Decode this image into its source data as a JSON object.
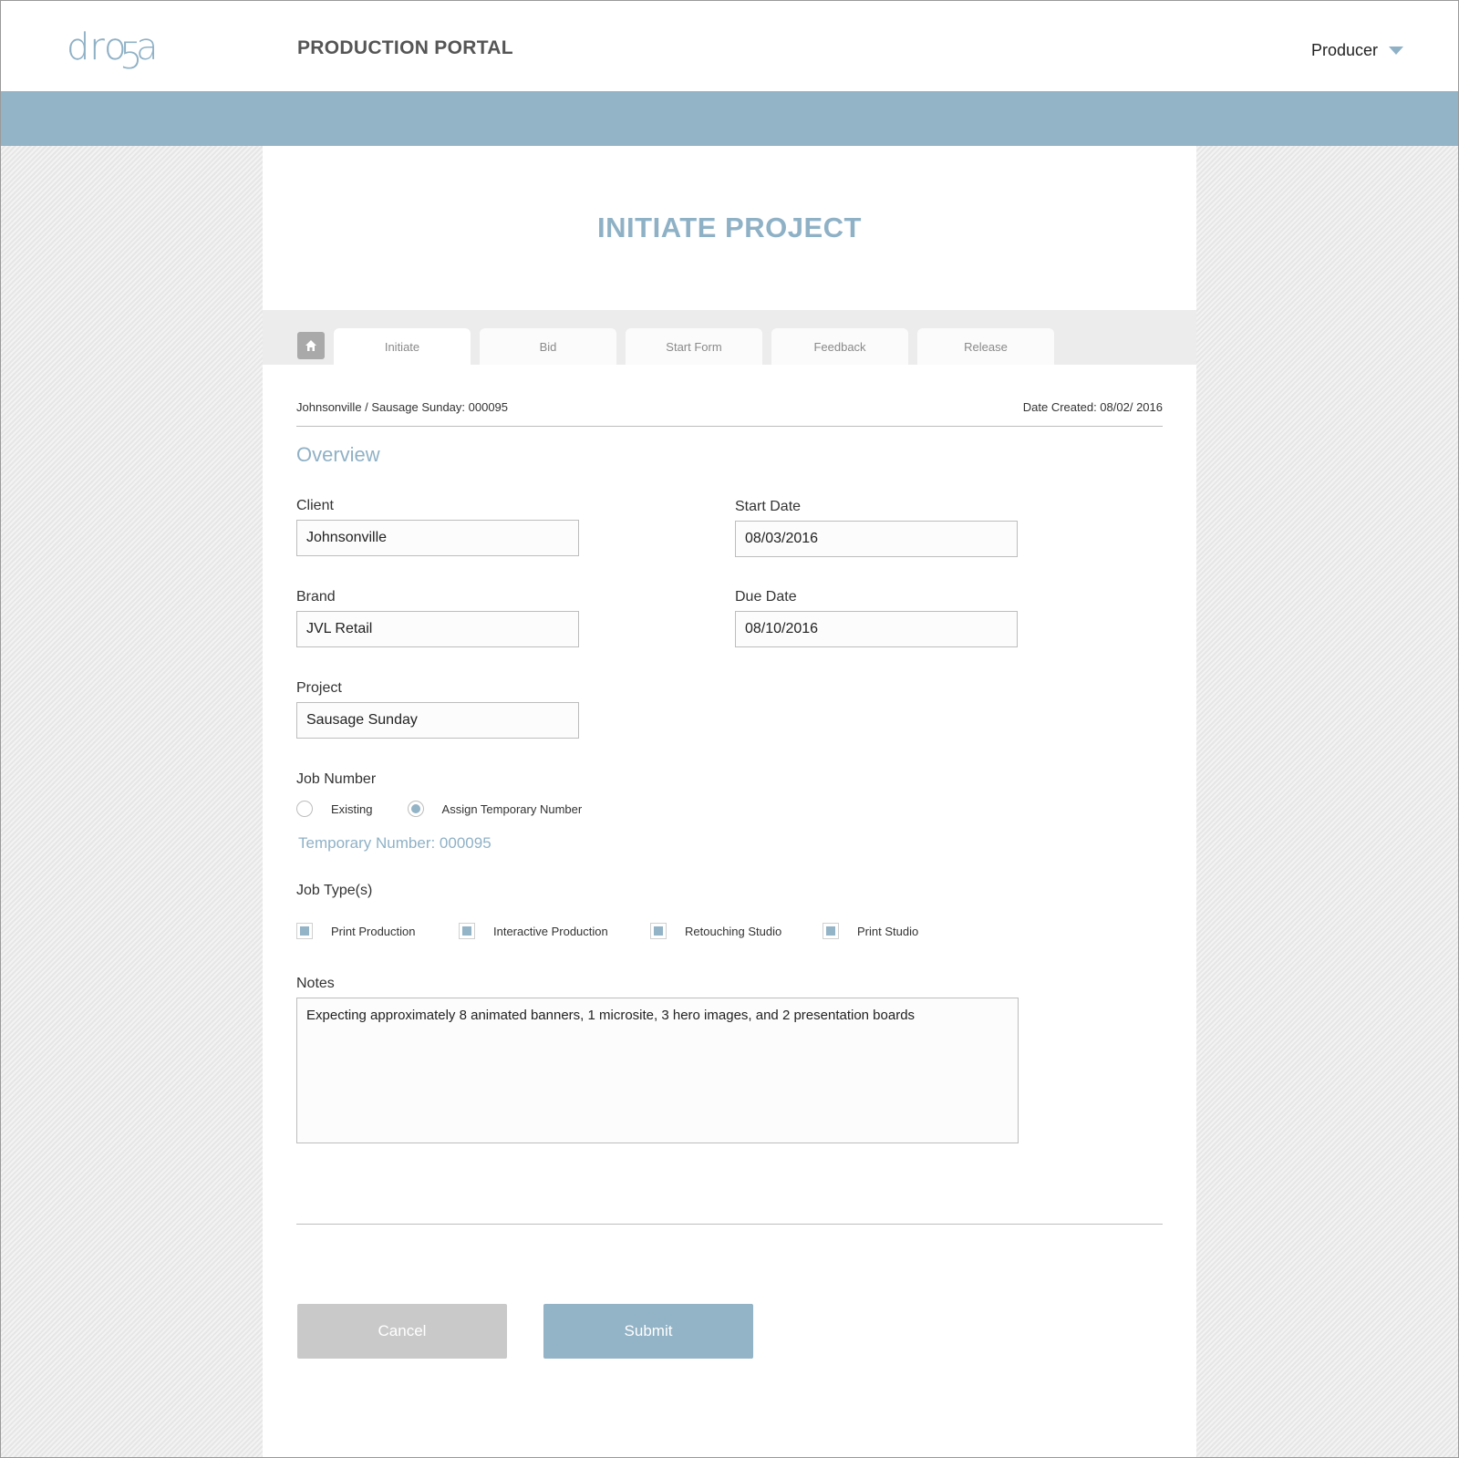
{
  "brand": {
    "logo_text": "dro5a",
    "accent_color": "#8fb1c6"
  },
  "header": {
    "portal_title": "PRODUCTION PORTAL",
    "user_role": "Producer",
    "user_menu_icon": "chevron-down-icon"
  },
  "page": {
    "title": "INITIATE PROJECT"
  },
  "tabs": {
    "home_icon": "home-icon",
    "items": [
      {
        "label": "Initiate",
        "active": true
      },
      {
        "label": "Bid",
        "active": false
      },
      {
        "label": "Start Form",
        "active": false
      },
      {
        "label": "Feedback",
        "active": false
      },
      {
        "label": "Release",
        "active": false
      }
    ]
  },
  "meta": {
    "breadcrumb": "Johnsonville / Sausage Sunday: 000095",
    "date_created": "Date Created: 08/02/ 2016"
  },
  "form": {
    "section_title": "Overview",
    "client": {
      "label": "Client",
      "value": "Johnsonville"
    },
    "brand": {
      "label": "Brand",
      "value": "JVL Retail"
    },
    "project": {
      "label": "Project",
      "value": "Sausage Sunday"
    },
    "start_date": {
      "label": "Start Date",
      "value": "08/03/2016"
    },
    "due_date": {
      "label": "Due Date",
      "value": "08/10/2016"
    },
    "job_number": {
      "label": "Job Number",
      "options": [
        {
          "label": "Existing",
          "selected": false
        },
        {
          "label": "Assign Temporary Number",
          "selected": true
        }
      ],
      "temporary_number": "Temporary Number: 000095"
    },
    "job_types": {
      "label": "Job Type(s)",
      "options": [
        {
          "label": "Print Production",
          "checked": true
        },
        {
          "label": "Interactive Production",
          "checked": true
        },
        {
          "label": "Retouching Studio",
          "checked": true
        },
        {
          "label": "Print Studio",
          "checked": true
        }
      ]
    },
    "notes": {
      "label": "Notes",
      "value": "Expecting approximately 8 animated banners, 1 microsite, 3 hero images, and 2 presentation boards"
    }
  },
  "actions": {
    "cancel_label": "Cancel",
    "submit_label": "Submit"
  }
}
